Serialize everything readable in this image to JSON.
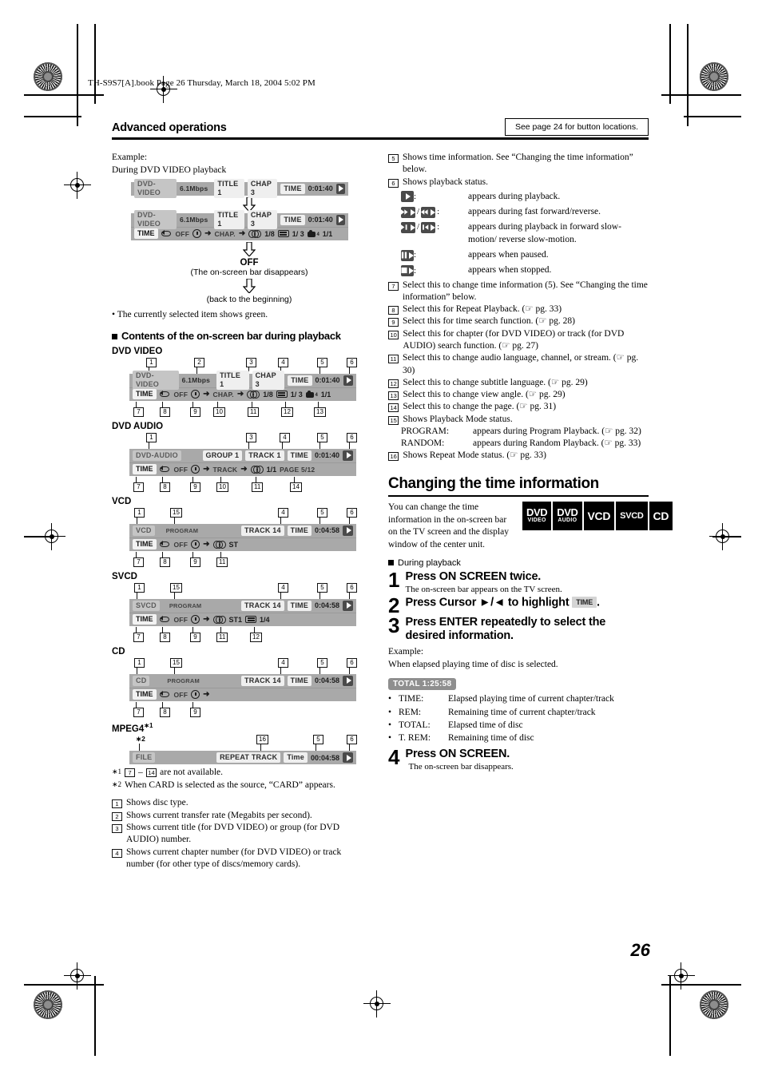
{
  "header": {
    "file_line": "TH-S9S7[A].book  Page 26  Thursday, March 18, 2004  5:02 PM",
    "running_head": "Advanced operations",
    "see_page_note": "See page 24 for button locations."
  },
  "page_number": "26",
  "left": {
    "example_label": "Example:",
    "example_sub": "During DVD VIDEO playback",
    "off_label": "OFF",
    "off_note": "(The on-screen bar disappears)",
    "back_note": "(back to the beginning)",
    "bullet_green": "• The currently selected item shows green.",
    "section_heading": "Contents of the on-screen bar during playback",
    "diagram_titles": {
      "dvd_video": "DVD VIDEO",
      "dvd_audio": "DVD AUDIO",
      "vcd": "VCD",
      "svcd": "SVCD",
      "cd": "CD",
      "mpeg4": "MPEG4"
    },
    "mpeg4_sup": "∗1",
    "mpeg4_card_sup": "∗2",
    "osd": {
      "dvd_video": {
        "disc": "DVD-VIDEO",
        "rate": "6.1Mbps",
        "title": "TITLE  1",
        "chap": "CHAP  3",
        "time_label": "TIME",
        "time_value": "0:01:40",
        "row2_time": "TIME",
        "repeat": "OFF",
        "chapter_search": "CHAP.",
        "audio": "1/8",
        "subtitle": "1/ 3",
        "angle": "1/1"
      },
      "dvd_audio": {
        "disc": "DVD-AUDIO",
        "group": "GROUP 1",
        "track": "TRACK 1",
        "time_label": "TIME",
        "time_value": "0:01:40",
        "row2_time": "TIME",
        "repeat": "OFF",
        "track_search": "TRACK",
        "audio": "1/1",
        "page": "PAGE 5/12"
      },
      "vcd": {
        "disc": "VCD",
        "program": "PROGRAM",
        "track": "TRACK 14",
        "time_label": "TIME",
        "time_value": "0:04:58",
        "row2_time": "TIME",
        "repeat": "OFF",
        "audio": "ST"
      },
      "svcd": {
        "disc": "SVCD",
        "program": "PROGRAM",
        "track": "TRACK 14",
        "time_label": "TIME",
        "time_value": "0:04:58",
        "row2_time": "TIME",
        "repeat": "OFF",
        "audio": "ST1",
        "subtitle": "1/4"
      },
      "cd": {
        "disc": "CD",
        "program": "PROGRAM",
        "track": "TRACK 14",
        "time_label": "TIME",
        "time_value": "0:04:58",
        "row2_time": "TIME",
        "repeat": "OFF"
      },
      "mpeg4": {
        "disc": "FILE",
        "repeat_mode": "REPEAT TRACK",
        "time_label": "Time",
        "time_value": "00:04:58"
      }
    },
    "footnotes": [
      {
        "mark": "∗1",
        "pre": "",
        "a": "7",
        "mid": "–",
        "b": "14",
        "post": "are not available."
      },
      {
        "mark": "∗2",
        "text": "When CARD is selected as the source, “CARD” appears."
      }
    ],
    "items": [
      {
        "n": "1",
        "text": "Shows disc type."
      },
      {
        "n": "2",
        "text": "Shows current transfer rate (Megabits per second)."
      },
      {
        "n": "3",
        "text": "Shows current title (for DVD VIDEO) or group (for DVD AUDIO) number."
      },
      {
        "n": "4",
        "text": "Shows current chapter number (for DVD VIDEO) or track number (for other type of discs/memory cards)."
      }
    ]
  },
  "right": {
    "items": [
      {
        "n": "5",
        "text": "Shows time information. See “Changing the time information” below."
      },
      {
        "n": "6",
        "text": "Shows playback status."
      },
      {
        "n": "7",
        "text": "Select this to change time information (5). See “Changing the time information” below."
      },
      {
        "n": "8",
        "text": "Select this for Repeat Playback. (☞ pg. 33)"
      },
      {
        "n": "9",
        "text": "Select this for time search function. (☞ pg. 28)"
      },
      {
        "n": "10",
        "text": "Select this for chapter (for DVD VIDEO) or track (for DVD AUDIO) search function. (☞ pg. 27)"
      },
      {
        "n": "11",
        "text": "Select this to change audio language, channel, or stream. (☞ pg. 30)"
      },
      {
        "n": "12",
        "text": "Select this to change subtitle language. (☞ pg. 29)"
      },
      {
        "n": "13",
        "text": "Select this to change view angle. (☞ pg. 29)"
      },
      {
        "n": "14",
        "text": "Select this to change the page. (☞ pg. 31)"
      },
      {
        "n": "15",
        "text": "Shows Playback Mode status."
      },
      {
        "n": "16",
        "text": "Shows Repeat Mode status. (☞ pg. 33)"
      }
    ],
    "status_rows": [
      {
        "icon": "play-icon",
        "text": "appears during playback."
      },
      {
        "icon": "fast-forward-reverse-icon",
        "text": "appears during fast forward/reverse."
      },
      {
        "icon": "slow-motion-icon",
        "text": "appears during playback in forward slow-motion/ reverse slow-motion."
      },
      {
        "icon": "pause-icon",
        "text": "appears when paused."
      },
      {
        "icon": "stop-icon",
        "text": "appears when stopped."
      }
    ],
    "playback_mode": {
      "program_label": "PROGRAM:",
      "program_text": "appears during Program Playback. (☞ pg. 32)",
      "random_label": "RANDOM:",
      "random_text": "appears during Random Playback. (☞ pg. 33)"
    },
    "section": {
      "heading": "Changing the time information",
      "intro": "You can change the time information in the on-screen bar on the TV screen and the display window of the center unit.",
      "during_playback": "During playback",
      "badges": [
        {
          "line1": "DVD",
          "line2": "VIDEO"
        },
        {
          "line1": "DVD",
          "line2": "AUDIO"
        },
        {
          "line1": "VCD",
          "line2": ""
        },
        {
          "line1": "SVCD",
          "line2": ""
        },
        {
          "line1": "CD",
          "line2": ""
        }
      ],
      "steps": [
        {
          "n": "1",
          "title": "Press ON SCREEN twice.",
          "sub": "The on-screen bar appears on the TV screen."
        },
        {
          "n": "2",
          "title_a": "Press Cursor ►/◄ to highlight",
          "key": "TIME",
          "title_b": ".",
          "sub": ""
        },
        {
          "n": "3",
          "title": "Press ENTER repeatedly to select the desired information.",
          "sub": ""
        },
        {
          "n": "4",
          "title": "Press ON SCREEN.",
          "sub": "The on-screen bar disappears."
        }
      ],
      "example_label": "Example:",
      "example_text": "When elapsed playing time of disc is selected.",
      "total_chip": "TOTAL  1:25:58",
      "definitions": [
        {
          "term": "TIME:",
          "desc": "Elapsed playing time of current chapter/track"
        },
        {
          "term": "REM:",
          "desc": "Remaining time of current chapter/track"
        },
        {
          "term": "TOTAL:",
          "desc": "Elapsed time of disc"
        },
        {
          "term": "T. REM:",
          "desc": "Remaining time of disc"
        }
      ]
    }
  },
  "colors": {
    "osd_bg": "#a9a9a9",
    "osd_chip": "#c5c5c5",
    "osd_chip_hl": "#efefef",
    "badge_bg": "#000000"
  }
}
